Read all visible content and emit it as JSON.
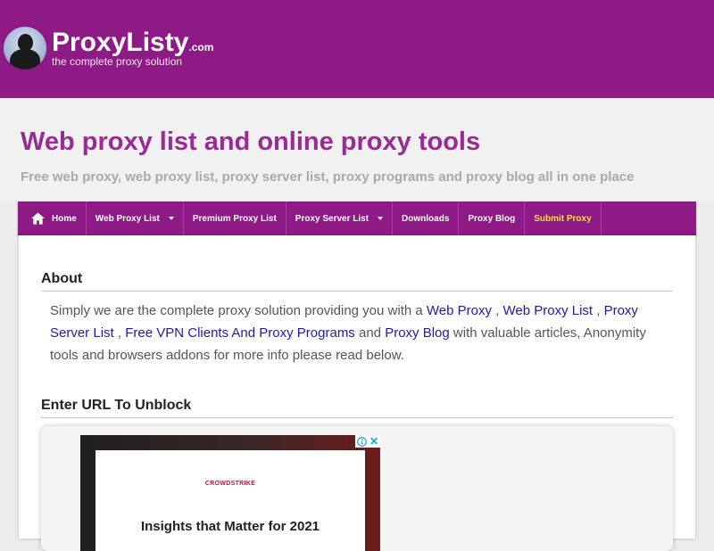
{
  "logo": {
    "brand": "ProxyListy",
    "dotcom": ".com",
    "tagline": "the complete proxy solution"
  },
  "header": {
    "title": "Web proxy list and online proxy tools",
    "subtitle": "Free web proxy, web proxy list, proxy server list, proxy programs and proxy blog all in one place"
  },
  "nav": {
    "home": "Home",
    "web_proxy_list": "Web Proxy List",
    "premium_proxy_list": "Premium Proxy List",
    "proxy_server_list": "Proxy Server List",
    "downloads": "Downloads",
    "proxy_blog": "Proxy Blog",
    "submit_proxy": "Submit Proxy"
  },
  "about": {
    "heading": "About",
    "text_1": "Simply we are the complete proxy solution providing you with a ",
    "link_web_proxy": "Web Proxy",
    "sep_1": " , ",
    "link_web_proxy_list": "Web Proxy List",
    "sep_2": " , ",
    "link_proxy_server_list": "Proxy Server List",
    "sep_3": " , ",
    "link_vpn": "Free VPN Clients And Proxy Programs",
    "text_and": " and ",
    "link_proxy_blog": "Proxy Blog",
    "text_2": " with valuable articles, Anonymity tools and browsers addons for more info please read below."
  },
  "unblock": {
    "heading": "Enter URL To Unblock"
  },
  "ad": {
    "logo_text": "CROWDSTRIKE",
    "headline": "Insights that Matter for 2021",
    "close_symbol": "✕"
  },
  "colors": {
    "brand_purple": "#8e1a86",
    "title_purple": "#9a2a96",
    "link_blue": "#1b1bae",
    "submit_yellow": "#ffe13a"
  }
}
